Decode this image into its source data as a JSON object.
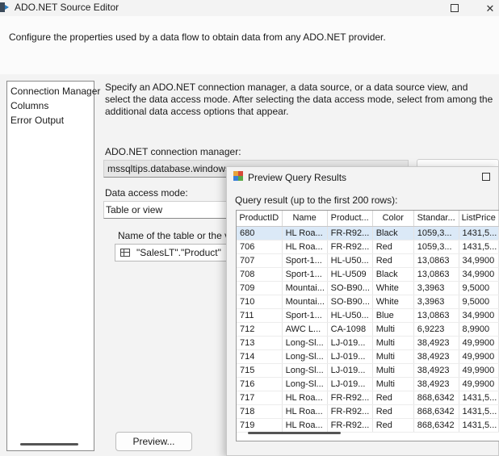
{
  "window": {
    "title": "ADO.NET Source Editor",
    "description": "Configure the properties used by a data flow to obtain data from any ADO.NET provider."
  },
  "nav": {
    "items": [
      {
        "label": "Connection Manager"
      },
      {
        "label": "Columns"
      },
      {
        "label": "Error Output"
      }
    ]
  },
  "main": {
    "intro": "Specify an ADO.NET connection manager, a data source, or a data source view, and select the data access mode. After selecting the data access mode, select from among the additional data access options that appear.",
    "connection_label": "ADO.NET connection manager:",
    "connection_value": "mssqltips.database.windows.n",
    "access_mode_label": "Data access mode:",
    "access_mode_value": "Table or view",
    "table_label": "Name of the table or the vi",
    "table_value": "\"SalesLT\".\"Product\"",
    "preview_button": "Preview..."
  },
  "preview_dialog": {
    "title": "Preview Query Results",
    "result_label": "Query result (up to the first 200 rows):",
    "columns": [
      "ProductID",
      "Name",
      "Product...",
      "Color",
      "Standar...",
      "ListPrice"
    ],
    "rows": [
      [
        "680",
        "HL Roa...",
        "FR-R92...",
        "Black",
        "1059,3...",
        "1431,5..."
      ],
      [
        "706",
        "HL Roa...",
        "FR-R92...",
        "Red",
        "1059,3...",
        "1431,5..."
      ],
      [
        "707",
        "Sport-1...",
        "HL-U50...",
        "Red",
        "13,0863",
        "34,9900"
      ],
      [
        "708",
        "Sport-1...",
        "HL-U509",
        "Black",
        "13,0863",
        "34,9900"
      ],
      [
        "709",
        "Mountai...",
        "SO-B90...",
        "White",
        "3,3963",
        "9,5000"
      ],
      [
        "710",
        "Mountai...",
        "SO-B90...",
        "White",
        "3,3963",
        "9,5000"
      ],
      [
        "711",
        "Sport-1...",
        "HL-U50...",
        "Blue",
        "13,0863",
        "34,9900"
      ],
      [
        "712",
        "AWC L...",
        "CA-1098",
        "Multi",
        "6,9223",
        "8,9900"
      ],
      [
        "713",
        "Long-Sl...",
        "LJ-019...",
        "Multi",
        "38,4923",
        "49,9900"
      ],
      [
        "714",
        "Long-Sl...",
        "LJ-019...",
        "Multi",
        "38,4923",
        "49,9900"
      ],
      [
        "715",
        "Long-Sl...",
        "LJ-019...",
        "Multi",
        "38,4923",
        "49,9900"
      ],
      [
        "716",
        "Long-Sl...",
        "LJ-019...",
        "Multi",
        "38,4923",
        "49,9900"
      ],
      [
        "717",
        "HL Roa...",
        "FR-R92...",
        "Red",
        "868,6342",
        "1431,5..."
      ],
      [
        "718",
        "HL Roa...",
        "FR-R92...",
        "Red",
        "868,6342",
        "1431,5..."
      ],
      [
        "719",
        "HL Roa...",
        "FR-R92...",
        "Red",
        "868,6342",
        "1431,5..."
      ]
    ]
  }
}
